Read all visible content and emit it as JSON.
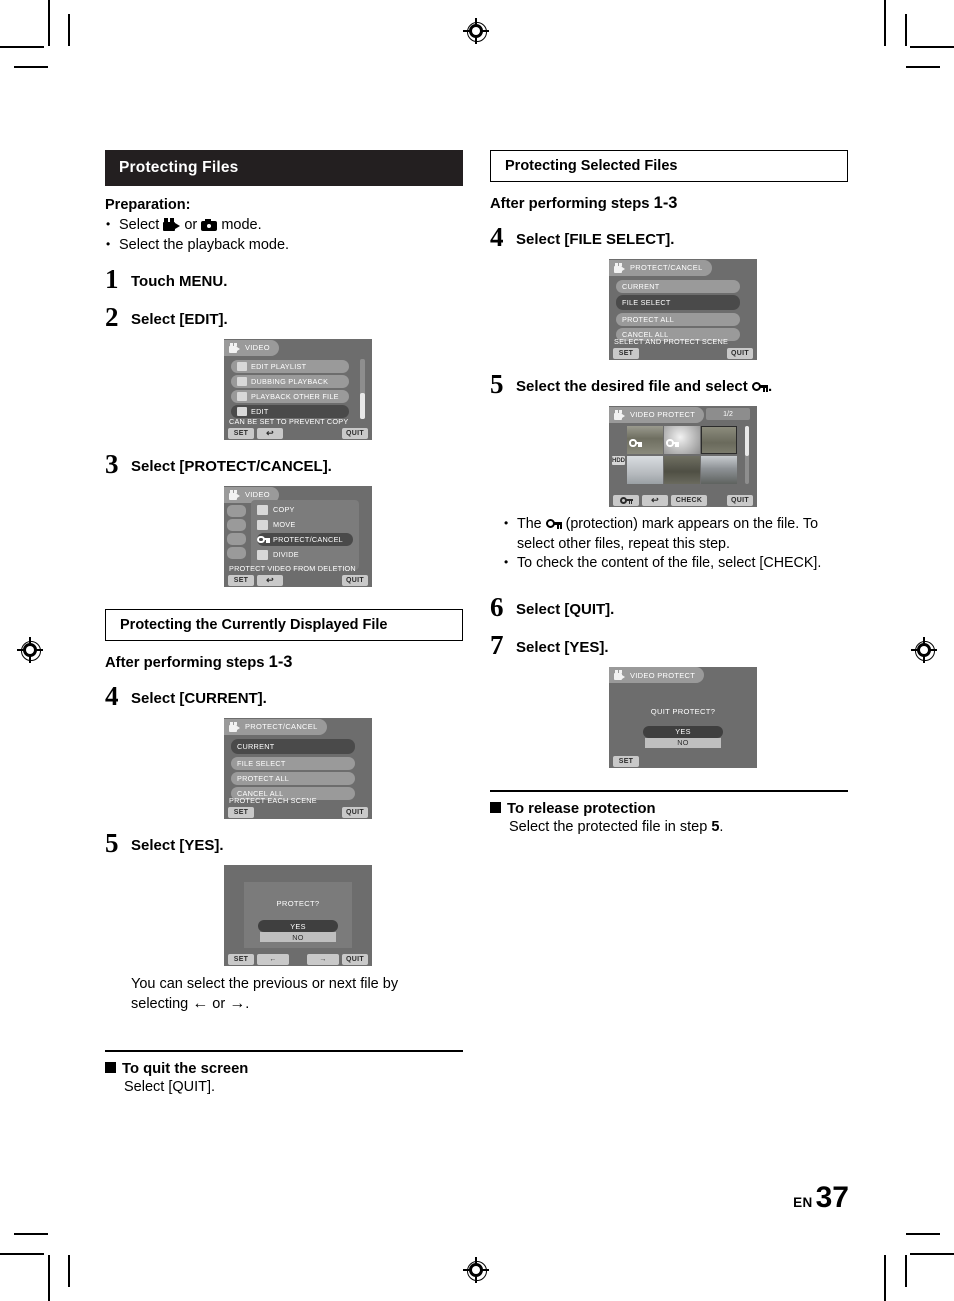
{
  "page": {
    "language_code": "EN",
    "number": "37"
  },
  "left_column": {
    "band_title": "Protecting Files",
    "preparation_label": "Preparation:",
    "preparation_items": [
      {
        "prefix": "Select ",
        "icon_video": "video-mode-icon",
        "middle": " or ",
        "icon_still": "still-mode-icon",
        "suffix": " mode."
      },
      {
        "text": "Select the playback mode."
      }
    ],
    "steps": [
      {
        "num": "1",
        "text": "Touch MENU."
      },
      {
        "num": "2",
        "text": "Select [EDIT]."
      },
      {
        "num": "3",
        "text": "Select [PROTECT/CANCEL]."
      }
    ],
    "section2": {
      "box_title": "Protecting the Currently Displayed File",
      "after_label": "After performing steps",
      "after_range": "1-3",
      "steps": [
        {
          "num": "4",
          "text": "Select [CURRENT]."
        },
        {
          "num": "5",
          "text": "Select [YES]."
        }
      ],
      "note_line1": "You can select the previous or next file by",
      "note_line2_pre": "selecting ",
      "note_left_arrow": "←",
      "note_mid": " or ",
      "note_right_arrow": "→",
      "note_end": ".",
      "quit_heading": "To quit the screen",
      "quit_body": "Select [QUIT]."
    }
  },
  "right_column": {
    "box_title": "Protecting Selected Files",
    "after_label": "After performing steps",
    "after_range": "1-3",
    "steps": [
      {
        "num": "4",
        "text": "Select [FILE SELECT]."
      },
      {
        "num": "5",
        "text_pre": "Select the desired file and select ",
        "icon": "protect-key-icon",
        "text_post": "."
      },
      {
        "num": "6",
        "text": "Select [QUIT]."
      },
      {
        "num": "7",
        "text": "Select [YES]."
      }
    ],
    "bullets": [
      {
        "pre": "The ",
        "icon": "protect-key-icon",
        "post": " (protection) mark appears on the file. To select other files, repeat this step."
      },
      {
        "text": "To check the content of the file, select [CHECK]."
      }
    ],
    "release_heading": "To release protection",
    "release_body_pre": "Select the protected file in step ",
    "release_step": "5",
    "release_body_post": "."
  },
  "lcd_screens": {
    "edit_menu": {
      "tab_label": "VIDEO",
      "tab_icon": "video-camera-icon",
      "rows": [
        {
          "label": "EDIT PLAYLIST",
          "icon": "playlist-icon",
          "selected": false
        },
        {
          "label": "DUBBING PLAYBACK",
          "icon": "dubbing-icon",
          "selected": false
        },
        {
          "label": "PLAYBACK OTHER FILE",
          "icon": "other-file-icon",
          "selected": false
        },
        {
          "label": "EDIT",
          "icon": "wrench-icon",
          "selected": true
        }
      ],
      "hint": "CAN BE SET TO PREVENT COPY",
      "buttons": {
        "set": "SET",
        "back": "back-arrow-icon",
        "quit": "QUIT"
      }
    },
    "protect_cancel_popup": {
      "tab_label": "VIDEO",
      "tab_icon": "video-camera-icon",
      "rows": [
        {
          "label": "COPY",
          "icon": "copy-icon",
          "selected": false
        },
        {
          "label": "MOVE",
          "icon": "move-icon",
          "selected": false
        },
        {
          "label": "PROTECT/CANCEL",
          "icon": "protect-key-icon",
          "selected": true
        },
        {
          "label": "DIVIDE",
          "icon": "divide-icon",
          "selected": false
        }
      ],
      "hint": "PROTECT VIDEO FROM DELETION",
      "buttons": {
        "set": "SET",
        "back": "back-arrow-icon",
        "quit": "QUIT"
      }
    },
    "protect_cancel_current": {
      "tab_label": "PROTECT/CANCEL",
      "tab_icon": "video-camera-icon",
      "rows": [
        {
          "label": "CURRENT",
          "selected": true
        },
        {
          "label": "FILE SELECT",
          "selected": false
        },
        {
          "label": "PROTECT ALL",
          "selected": false
        },
        {
          "label": "CANCEL ALL",
          "selected": false
        }
      ],
      "hint": "PROTECT EACH SCENE",
      "buttons": {
        "set": "SET",
        "quit": "QUIT"
      }
    },
    "protect_confirm": {
      "question": "PROTECT?",
      "yes": "YES",
      "no": "NO",
      "buttons": {
        "set": "SET",
        "prev": "←",
        "next": "→",
        "quit": "QUIT"
      }
    },
    "protect_cancel_fileselect": {
      "tab_label": "PROTECT/CANCEL",
      "tab_icon": "video-camera-icon",
      "rows": [
        {
          "label": "CURRENT",
          "selected": false
        },
        {
          "label": "FILE SELECT",
          "selected": true
        },
        {
          "label": "PROTECT ALL",
          "selected": false
        },
        {
          "label": "CANCEL ALL",
          "selected": false
        }
      ],
      "hint": "SELECT AND PROTECT SCENE",
      "buttons": {
        "set": "SET",
        "quit": "QUIT"
      }
    },
    "video_protect_grid": {
      "tab_label": "VIDEO PROTECT",
      "tab_icon": "video-camera-icon",
      "page_indicator": "1/2",
      "media_badge": "HDD",
      "thumbnails": [
        {
          "index": 1,
          "protected": true,
          "selected": false
        },
        {
          "index": 2,
          "protected": true,
          "selected": false
        },
        {
          "index": 3,
          "protected": false,
          "selected": true
        },
        {
          "index": 4,
          "protected": false,
          "selected": false
        },
        {
          "index": 5,
          "protected": false,
          "selected": false
        },
        {
          "index": 6,
          "protected": false,
          "selected": false
        }
      ],
      "buttons": {
        "protect": "protect-key-icon",
        "back": "back-arrow-icon",
        "check": "CHECK",
        "quit": "QUIT"
      }
    },
    "quit_protect_confirm": {
      "tab_label": "VIDEO PROTECT",
      "tab_icon": "video-camera-icon",
      "question": "QUIT PROTECT?",
      "yes": "YES",
      "no": "NO",
      "buttons": {
        "set": "SET"
      }
    }
  }
}
